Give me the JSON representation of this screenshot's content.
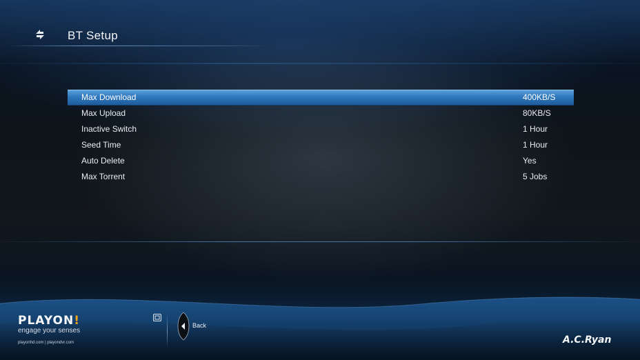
{
  "header": {
    "title": "BT Setup",
    "icon": "settings-arrows-icon"
  },
  "settings": {
    "selected_index": 0,
    "items": [
      {
        "label": "Max Download",
        "value": "400KB/S"
      },
      {
        "label": "Max Upload",
        "value": "80KB/S"
      },
      {
        "label": "Inactive Switch",
        "value": "1 Hour"
      },
      {
        "label": "Seed Time",
        "value": "1 Hour"
      },
      {
        "label": "Auto Delete",
        "value": "Yes"
      },
      {
        "label": "Max Torrent",
        "value": "5 Jobs"
      }
    ]
  },
  "footer": {
    "brand_name_main": "PLAYON",
    "brand_name_accent": "!",
    "brand_tagline": "engage your senses",
    "brand_sites": "playonhd.com | playondvr.com",
    "back_label": "Back",
    "vendor_logo": "A.C.Ryan"
  },
  "colors": {
    "selection": "#2f78bd",
    "brand_accent": "#f2a21b"
  }
}
